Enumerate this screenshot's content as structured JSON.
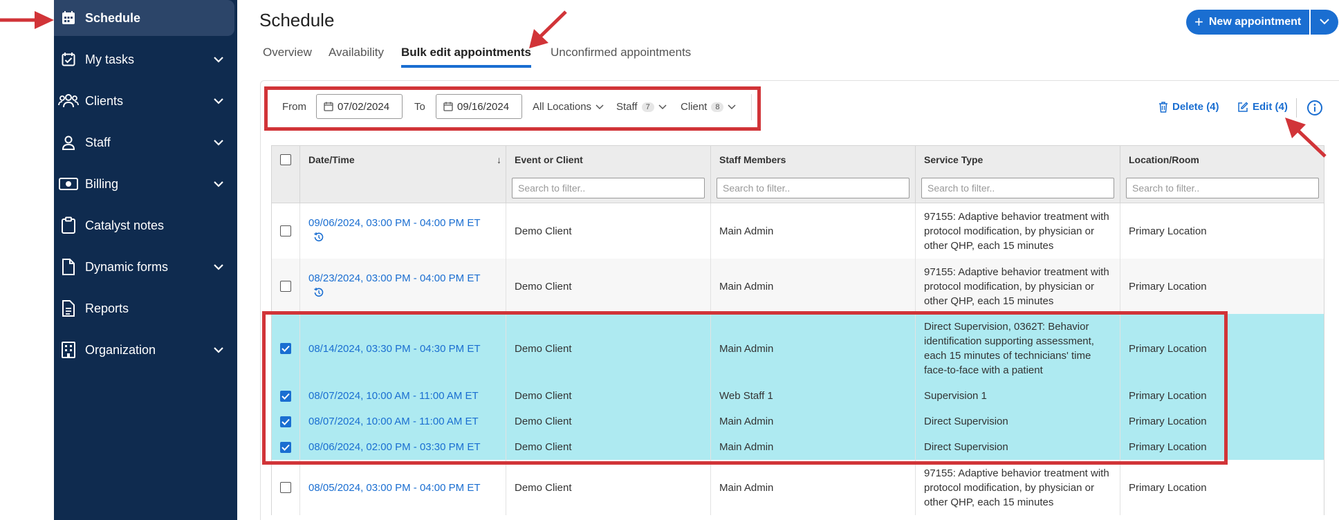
{
  "sidebar": {
    "items": [
      {
        "label": "Schedule",
        "active": true,
        "icon": "calendar-icon",
        "expandable": false
      },
      {
        "label": "My tasks",
        "icon": "calendar-check-icon",
        "expandable": true
      },
      {
        "label": "Clients",
        "icon": "users-icon",
        "expandable": true
      },
      {
        "label": "Staff",
        "icon": "staff-icon",
        "expandable": true
      },
      {
        "label": "Billing",
        "icon": "billing-icon",
        "expandable": true
      },
      {
        "label": "Catalyst notes",
        "icon": "clipboard-icon",
        "expandable": false
      },
      {
        "label": "Dynamic forms",
        "icon": "document-icon",
        "expandable": true
      },
      {
        "label": "Reports",
        "icon": "report-icon",
        "expandable": false
      },
      {
        "label": "Organization",
        "icon": "building-icon",
        "expandable": true
      }
    ]
  },
  "header": {
    "title": "Schedule",
    "new_button": "New appointment",
    "tabs": [
      {
        "label": "Overview"
      },
      {
        "label": "Availability"
      },
      {
        "label": "Bulk edit appointments",
        "active": true
      },
      {
        "label": "Unconfirmed appointments"
      }
    ]
  },
  "filters": {
    "from_label": "From",
    "from_value": "07/02/2024",
    "to_label": "To",
    "to_value": "09/16/2024",
    "locations": "All Locations",
    "staff": "Staff",
    "staff_count": "7",
    "client": "Client",
    "client_count": "8"
  },
  "actions": {
    "delete": "Delete (4)",
    "edit": "Edit (4)"
  },
  "table": {
    "columns": [
      "Date/Time",
      "Event or Client",
      "Staff Members",
      "Service Type",
      "Location/Room"
    ],
    "filter_placeholder": "Search to filter..",
    "rows": [
      {
        "date": "09/06/2024, 03:00 PM - 04:00 PM ET",
        "recurring": true,
        "client": "Demo Client",
        "staff": "Main Admin",
        "service": "97155: Adaptive behavior treatment with protocol modification, by physician or other QHP, each 15 minutes",
        "location": "Primary Location",
        "checked": false
      },
      {
        "date": "08/23/2024, 03:00 PM - 04:00 PM ET",
        "recurring": true,
        "client": "Demo Client",
        "staff": "Main Admin",
        "service": "97155: Adaptive behavior treatment with protocol modification, by physician or other QHP, each 15 minutes",
        "location": "Primary Location",
        "checked": false
      },
      {
        "date": "08/14/2024, 03:30 PM - 04:30 PM ET",
        "recurring": false,
        "client": "Demo Client",
        "staff": "Main Admin",
        "service": "Direct Supervision, 0362T: Behavior identification supporting assessment, each 15 minutes of technicians' time face-to-face with a patient",
        "location": "Primary Location",
        "checked": true
      },
      {
        "date": "08/07/2024, 10:00 AM - 11:00 AM ET",
        "recurring": false,
        "client": "Demo Client",
        "staff": "Web Staff 1",
        "service": "Supervision 1",
        "location": "Primary Location",
        "checked": true
      },
      {
        "date": "08/07/2024, 10:00 AM - 11:00 AM ET",
        "recurring": false,
        "client": "Demo Client",
        "staff": "Main Admin",
        "service": "Direct Supervision",
        "location": "Primary Location",
        "checked": true
      },
      {
        "date": "08/06/2024, 02:00 PM - 03:30 PM ET",
        "recurring": false,
        "client": "Demo Client",
        "staff": "Main Admin",
        "service": "Direct Supervision",
        "location": "Primary Location",
        "checked": true
      },
      {
        "date": "08/05/2024, 03:00 PM - 04:00 PM ET",
        "recurring": false,
        "client": "Demo Client",
        "staff": "Main Admin",
        "service": "97155: Adaptive behavior treatment with protocol modification, by physician or other QHP, each 15 minutes",
        "location": "Primary Location",
        "checked": false
      }
    ]
  },
  "colors": {
    "sidebar_bg": "#0f2b4f",
    "accent": "#1a6ed1",
    "selected_row": "#aeeaf1",
    "annotation": "#d13438"
  }
}
